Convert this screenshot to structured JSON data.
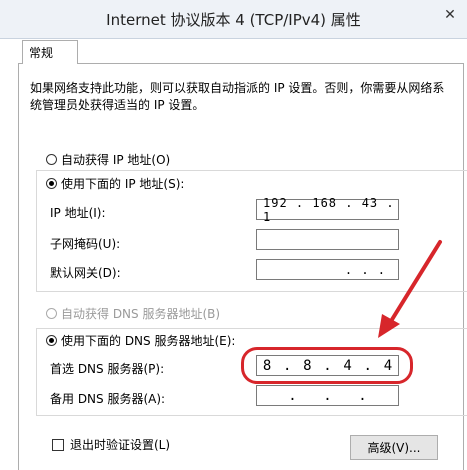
{
  "window": {
    "title": "Internet 协议版本 4 (TCP/IPv4) 属性",
    "close_icon": "close-icon"
  },
  "tabs": [
    {
      "label": "常规"
    }
  ],
  "description": "如果网络支持此功能，则可以获取自动指派的 IP 设置。否则，你需要从网络系统管理员处获得适当的 IP 设置。",
  "ip_mode": {
    "auto_label": "自动获得 IP 地址(O)",
    "manual_label": "使用下面的 IP 地址(S):",
    "selected": "manual"
  },
  "ip_fields": {
    "ip_label": "IP 地址(I):",
    "ip_value": "192 . 168 . 43 . 1",
    "mask_label": "子网掩码(U):",
    "mask_value": "",
    "gateway_label": "默认网关(D):",
    "gateway_value": ". . ."
  },
  "dns_mode": {
    "auto_label": "自动获得 DNS 服务器地址(B)",
    "manual_label": "使用下面的 DNS 服务器地址(E):",
    "selected": "manual"
  },
  "dns_fields": {
    "preferred_label": "首选 DNS 服务器(P):",
    "preferred_octets": [
      "8",
      ".",
      "8",
      ".",
      "4",
      ".",
      "4"
    ],
    "alternate_label": "备用 DNS 服务器(A):",
    "alternate_octets": [
      ".",
      ".",
      "."
    ]
  },
  "footer": {
    "validate_label": "退出时验证设置(L)",
    "validate_checked": false,
    "advanced_label": "高级(V)..."
  },
  "annotation_color": "#d7262b"
}
